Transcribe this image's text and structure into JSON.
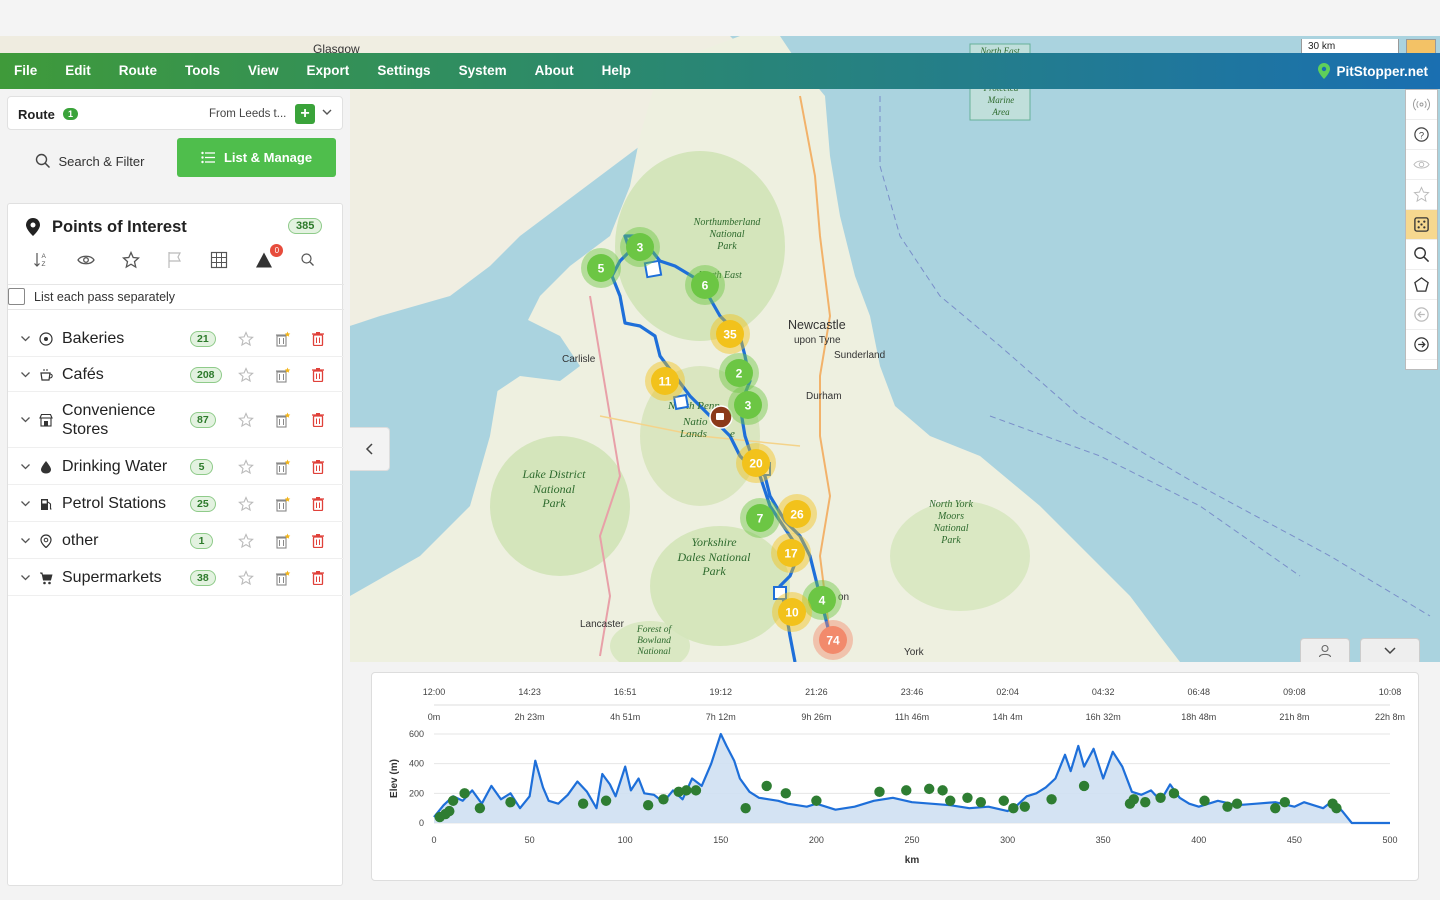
{
  "menubar": {
    "items": [
      "File",
      "Edit",
      "Route",
      "Tools",
      "View",
      "Export",
      "Settings",
      "System",
      "About",
      "Help"
    ],
    "brand": "PitStopper.net"
  },
  "map": {
    "scale_label": "30 km",
    "place_labels": {
      "glasgow": "Glasgow",
      "newcastle": "Newcastle",
      "upon_tyne": "upon Tyne",
      "sunderland": "Sunderland",
      "carlisle": "Carlisle",
      "durham": "Durham",
      "lancaster": "Lancaster",
      "york": "York",
      "north_east": "North East",
      "north_east_top": "North East",
      "pennines_fragment": "North Pennines",
      "protected_area": [
        "Protected",
        "Marine",
        "Area"
      ],
      "on_fragment": "on"
    },
    "park_labels": {
      "northumberland": [
        "Northumberland",
        "National",
        "Park"
      ],
      "lake_district": [
        "Lake District",
        "National",
        "Park"
      ],
      "north_pennines": [
        "N",
        "th Penn",
        "Natio",
        "Lands",
        "e"
      ],
      "yorkshire_dales": [
        "Yorkshire",
        "Dales National",
        "Park"
      ],
      "north_york_moors": [
        "North York",
        "Moors",
        "National",
        "Park"
      ],
      "forest_of_bowland": [
        "Forest of",
        "Bowland",
        "National"
      ]
    },
    "clusters": [
      {
        "label": "3",
        "color": "green"
      },
      {
        "label": "5",
        "color": "green"
      },
      {
        "label": "6",
        "color": "green"
      },
      {
        "label": "35",
        "color": "yellow"
      },
      {
        "label": "2",
        "color": "green"
      },
      {
        "label": "11",
        "color": "yellow"
      },
      {
        "label": "3",
        "color": "green"
      },
      {
        "label": "20",
        "color": "yellow"
      },
      {
        "label": "26",
        "color": "yellow"
      },
      {
        "label": "7",
        "color": "green"
      },
      {
        "label": "17",
        "color": "yellow"
      },
      {
        "label": "4",
        "color": "green"
      },
      {
        "label": "10",
        "color": "yellow"
      },
      {
        "label": "74",
        "color": "red"
      }
    ],
    "colors": {
      "water": "#aad3df",
      "land": "#f2efe9",
      "route": "#1e6fd9",
      "green_cluster": "#6cc644",
      "yellow_cluster": "#f2c21b",
      "red_cluster": "#f28a6c"
    }
  },
  "route": {
    "label": "Route",
    "count": "1",
    "from": "From Leeds t...",
    "add": "+"
  },
  "tabs": {
    "search": "Search & Filter",
    "list": "List & Manage"
  },
  "poi": {
    "title": "Points of Interest",
    "count": "385",
    "warning_count": "0",
    "pass_label": "List each pass separately",
    "categories": [
      {
        "label": "Bakeries",
        "count": "21",
        "icon": "bakery-icon"
      },
      {
        "label": "Cafés",
        "count": "208",
        "icon": "cafe-icon"
      },
      {
        "label": "Convenience Stores",
        "count": "87",
        "icon": "store-icon"
      },
      {
        "label": "Drinking Water",
        "count": "5",
        "icon": "water-drop-icon"
      },
      {
        "label": "Petrol Stations",
        "count": "25",
        "icon": "fuel-icon"
      },
      {
        "label": "other",
        "count": "1",
        "icon": "pin-icon"
      },
      {
        "label": "Supermarkets",
        "count": "38",
        "icon": "cart-icon"
      }
    ]
  },
  "elevation": {
    "time_ticks": [
      "12:00",
      "14:23",
      "16:51",
      "19:12",
      "21:26",
      "23:46",
      "02:04",
      "04:32",
      "06:48",
      "09:08",
      "10:08"
    ],
    "duration_ticks": [
      "0m",
      "2h 23m",
      "4h 51m",
      "7h 12m",
      "9h 26m",
      "11h 46m",
      "14h 4m",
      "16h 32m",
      "18h 48m",
      "21h 8m",
      "22h 8m"
    ],
    "y_ticks": [
      "0",
      "200",
      "400",
      "600"
    ],
    "x_ticks": [
      "0",
      "50",
      "100",
      "150",
      "200",
      "250",
      "300",
      "350",
      "400",
      "450",
      "500"
    ],
    "ylabel": "Elev (m)",
    "xlabel": "km"
  },
  "chart_data": {
    "type": "area",
    "ylabel": "Elev (m)",
    "xlabel": "km",
    "xlim": [
      0,
      500
    ],
    "ylim": [
      0,
      600
    ],
    "x": [
      0,
      5,
      10,
      15,
      20,
      25,
      30,
      35,
      40,
      45,
      50,
      53,
      57,
      60,
      65,
      70,
      75,
      80,
      85,
      88,
      92,
      95,
      100,
      103,
      107,
      110,
      115,
      120,
      125,
      130,
      135,
      140,
      145,
      150,
      153,
      157,
      160,
      165,
      170,
      175,
      180,
      185,
      190,
      195,
      200,
      210,
      220,
      230,
      240,
      250,
      260,
      270,
      280,
      290,
      300,
      305,
      310,
      315,
      320,
      325,
      330,
      333,
      337,
      340,
      345,
      350,
      355,
      360,
      365,
      370,
      375,
      380,
      385,
      390,
      395,
      400,
      410,
      420,
      430,
      440,
      450,
      455,
      460,
      465,
      470,
      475,
      480,
      500
    ],
    "y": [
      40,
      120,
      180,
      150,
      220,
      130,
      250,
      160,
      200,
      100,
      180,
      420,
      240,
      150,
      130,
      190,
      280,
      210,
      100,
      330,
      260,
      180,
      380,
      220,
      300,
      200,
      190,
      140,
      220,
      160,
      300,
      250,
      400,
      600,
      520,
      420,
      300,
      210,
      170,
      160,
      150,
      130,
      120,
      110,
      130,
      90,
      110,
      150,
      170,
      140,
      130,
      120,
      100,
      110,
      80,
      120,
      180,
      200,
      240,
      300,
      460,
      350,
      520,
      380,
      500,
      300,
      480,
      380,
      210,
      190,
      220,
      150,
      260,
      170,
      130,
      110,
      150,
      120,
      130,
      140,
      110,
      140,
      120,
      100,
      150,
      80,
      0,
      0
    ],
    "markers_x": [
      3,
      6,
      8,
      10,
      16,
      24,
      40,
      78,
      90,
      112,
      120,
      128,
      132,
      137,
      163,
      174,
      184,
      200,
      233,
      247,
      259,
      266,
      270,
      279,
      286,
      298,
      303,
      309,
      323,
      340,
      364,
      366,
      372,
      380,
      387,
      403,
      415,
      420,
      440,
      445,
      470,
      472
    ],
    "markers_y": [
      40,
      60,
      80,
      150,
      200,
      100,
      140,
      130,
      150,
      120,
      160,
      210,
      220,
      220,
      100,
      250,
      200,
      150,
      210,
      220,
      230,
      220,
      150,
      170,
      140,
      150,
      100,
      110,
      160,
      250,
      130,
      160,
      140,
      170,
      200,
      150,
      110,
      130,
      100,
      140,
      130,
      100
    ],
    "top_axis_time": [
      "12:00",
      "14:23",
      "16:51",
      "19:12",
      "21:26",
      "23:46",
      "02:04",
      "04:32",
      "06:48",
      "09:08",
      "10:08"
    ],
    "top_axis_duration": [
      "0m",
      "2h 23m",
      "4h 51m",
      "7h 12m",
      "9h 26m",
      "11h 46m",
      "14h 4m",
      "16h 32m",
      "18h 48m",
      "21h 8m",
      "22h 8m"
    ],
    "grid": true
  }
}
